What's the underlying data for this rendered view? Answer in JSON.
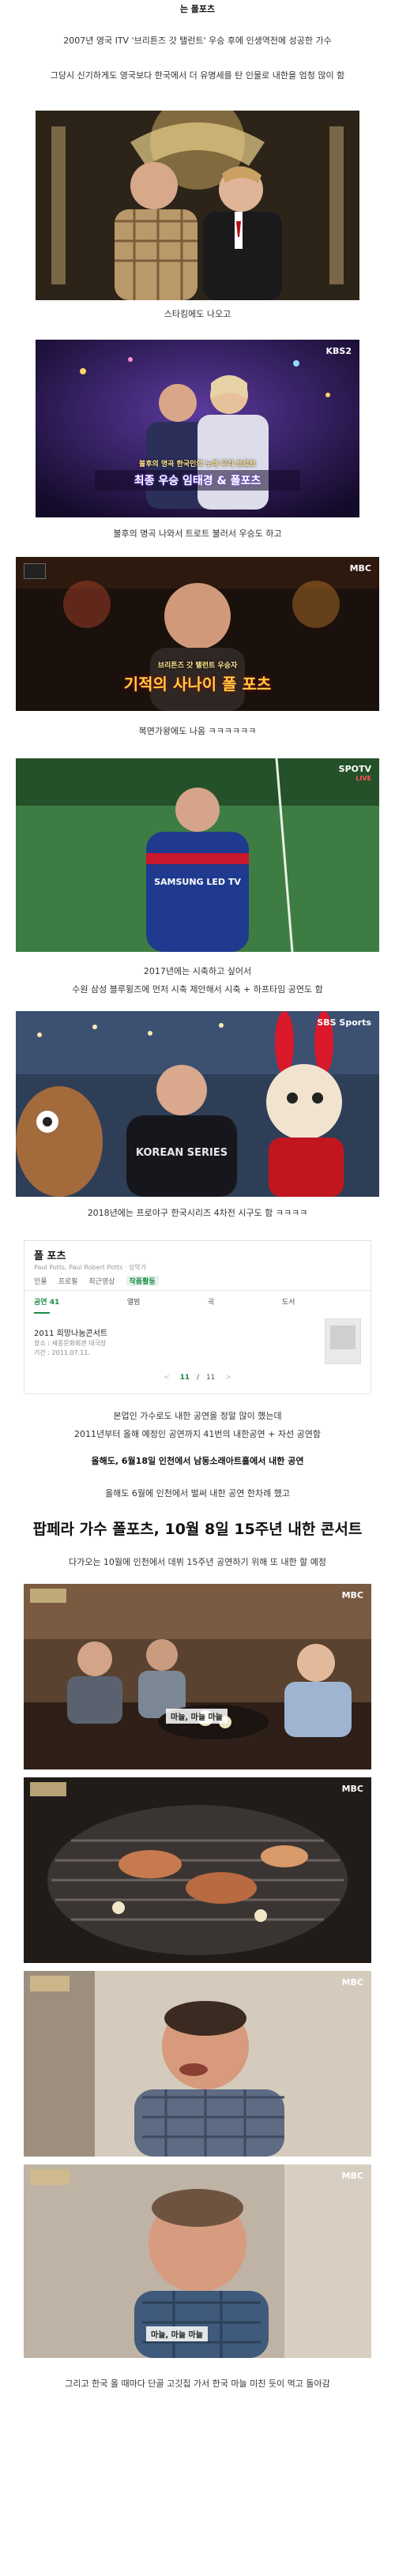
{
  "lines": {
    "l0": "는 폴포츠",
    "l1": "2007년 영국 ITV '브리튼즈 갓 탤런트' 우승 후에 인생역전에 성공한 가수",
    "l2": "그당시 신기하게도 영국보다 한국에서 더 유명세를 탄 인물로 내한을 엄청 많이 함",
    "l3": "스타킹에도 나오고",
    "l4": "불후의 명곡 나와서 트로트 불러서 우승도 하고",
    "l5": "복면가왕에도 나옴 ㅋㅋㅋㅋㅋㅋ",
    "l6": "2017년에는 시축하고 싶어서",
    "l7": "수원 삼성 블루윙즈에 먼저 시축 제안해서 시축 + 하프타임 공연도 함",
    "l8": "2018년에는 프로야구 한국시리즈 4차전 시구도 함 ㅋㅋㅋㅋ",
    "l9": "본업인 가수로도 내한 공연을 정말 많이 했는데",
    "l10": "2011년부터 올해 예정인 공연까지 41번의 내한공연 + 자선 공연함",
    "l11": "올해도, 6월18일 인천에서 남동소래아트홀에서 내한 공연",
    "l12": "올해도 6월에 인천에서 벌써 내한 공연 한차례 했고",
    "headline": "팝페라 가수 폴포츠, 10월 8일 15주년 내한 콘서트",
    "l13": "다가오는 10월에 인천에서 데뷔 15주년 공연하기 위해 또 내한 할 예정",
    "l14": "그리고 한국 올 때마다 단골 고깃집 가서 한국 마늘 미친 듯이 먹고 돌아감"
  },
  "overlays": {
    "kbs": "KBS2",
    "mbc": "MBC",
    "spotv": "SPOTV",
    "spotv_live": "LIVE",
    "sbs": "SBS Sports",
    "bulhu_small": "불후의 명곡 한국인의 노래 우리 트로트",
    "bulhu_big": "최종 우승 임태경 & 폴포츠",
    "mask_small": "브리튼즈 갓 탤런트 우승자",
    "mask_big": "기적의 사나이 폴 포츠",
    "jersey": "SAMSUNG LED TV",
    "korean_series": "KOREAN SERIES",
    "garlic": "마늘, 마늘 마늘"
  },
  "search_card": {
    "title": "폴 포츠",
    "subtitle": "Paul Potts, Paul Robert Potts · 성악가",
    "tabs": [
      "인물",
      "프로필",
      "최근영상",
      "작품활동"
    ],
    "active_tab": "작품활동",
    "subtabs": [
      "공연",
      "앨범",
      "곡",
      "도서"
    ],
    "subtab_count": "41",
    "item_title": "2011 희망나눔콘서트",
    "item_place": "장소 : 세종문화회관 대극장",
    "item_date": "기간 : 2011.07.11.",
    "pager_current": "11",
    "pager_total": "11",
    "prev_label": "<",
    "next_label": ">"
  }
}
